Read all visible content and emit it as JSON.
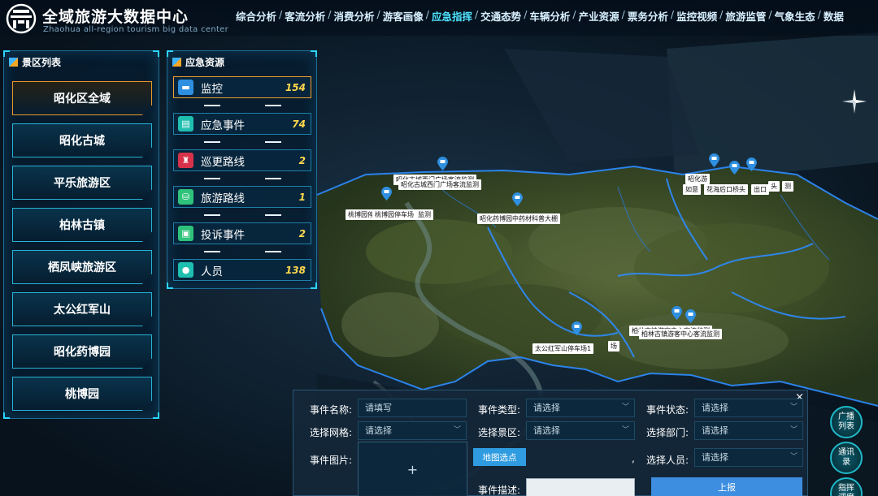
{
  "header": {
    "title": "全域旅游大数据中心",
    "subtitle": "Zhaohua all-region tourism big data center",
    "nav": [
      {
        "label": "综合分析",
        "active": false
      },
      {
        "label": "客流分析",
        "active": false
      },
      {
        "label": "消费分析",
        "active": false
      },
      {
        "label": "游客画像",
        "active": false
      },
      {
        "label": "应急指挥",
        "active": true
      },
      {
        "label": "交通态势",
        "active": false
      },
      {
        "label": "车辆分析",
        "active": false
      },
      {
        "label": "产业资源",
        "active": false
      },
      {
        "label": "票务分析",
        "active": false
      },
      {
        "label": "监控视频",
        "active": false
      },
      {
        "label": "旅游监管",
        "active": false
      },
      {
        "label": "气象生态",
        "active": false
      },
      {
        "label": "数据",
        "active": false
      }
    ],
    "nav_separator": "/"
  },
  "scenic_panel": {
    "title": "景区列表",
    "items": [
      {
        "label": "昭化区全域",
        "active": true
      },
      {
        "label": "昭化古城",
        "active": false
      },
      {
        "label": "平乐旅游区",
        "active": false
      },
      {
        "label": "柏林古镇",
        "active": false
      },
      {
        "label": "栖凤峡旅游区",
        "active": false
      },
      {
        "label": "太公红军山",
        "active": false
      },
      {
        "label": "昭化药博园",
        "active": false
      },
      {
        "label": "桃博园",
        "active": false
      }
    ]
  },
  "emergency_panel": {
    "title": "应急资源",
    "items": [
      {
        "label": "监控",
        "count": "154",
        "icon": "camera-icon",
        "color": "#2f8fe0",
        "active": true
      },
      {
        "label": "应急事件",
        "count": "74",
        "icon": "document-icon",
        "color": "#1fbfb0",
        "active": false
      },
      {
        "label": "巡更路线",
        "count": "2",
        "icon": "patrol-icon",
        "color": "#d8324a",
        "active": false
      },
      {
        "label": "旅游路线",
        "count": "1",
        "icon": "route-icon",
        "color": "#2ec27a",
        "active": false
      },
      {
        "label": "投诉事件",
        "count": "2",
        "icon": "complaint-icon",
        "color": "#2ec27a",
        "active": false
      },
      {
        "label": "人员",
        "count": "138",
        "icon": "person-icon",
        "color": "#1fbfb0",
        "active": false
      }
    ]
  },
  "map_labels": [
    "昭化古城西门广场客流监测",
    "昭化古城西门广场客流监测",
    "桃博园停车场",
    "桃博园停车场",
    "监测",
    "昭化药博园中药材科普大棚",
    "花海后口桥头",
    "出口",
    "头",
    "测",
    "如意",
    "昭化游",
    "柏林古镇游客中心客流监测",
    "柏林古镇游客中心客流监测",
    "太公红军山停车场1",
    "场"
  ],
  "side_buttons": [
    "广播列表",
    "通讯录",
    "指挥调度"
  ],
  "event_form": {
    "close_label": "×",
    "name_label": "事件名称:",
    "name_placeholder": "请填写",
    "type_label": "事件类型:",
    "type_value": "请选择",
    "status_label": "事件状态:",
    "status_value": "请选择",
    "grid_label": "选择网格:",
    "grid_value": "请选择",
    "scenic_label": "选择景区:",
    "scenic_value": "请选择",
    "dept_label": "选择部门:",
    "dept_value": "请选择",
    "image_label": "事件图片:",
    "image_add": "+",
    "map_select_label": "地图选点",
    "comma": ",",
    "person_label": "选择人员:",
    "person_value": "请选择",
    "desc_label": "事件描述:",
    "submit_label": "上报"
  },
  "colors": {
    "accent": "#4fe3ff",
    "active_border": "#e89a2a",
    "count": "#ffd84d",
    "submit": "#3d8ee0"
  }
}
